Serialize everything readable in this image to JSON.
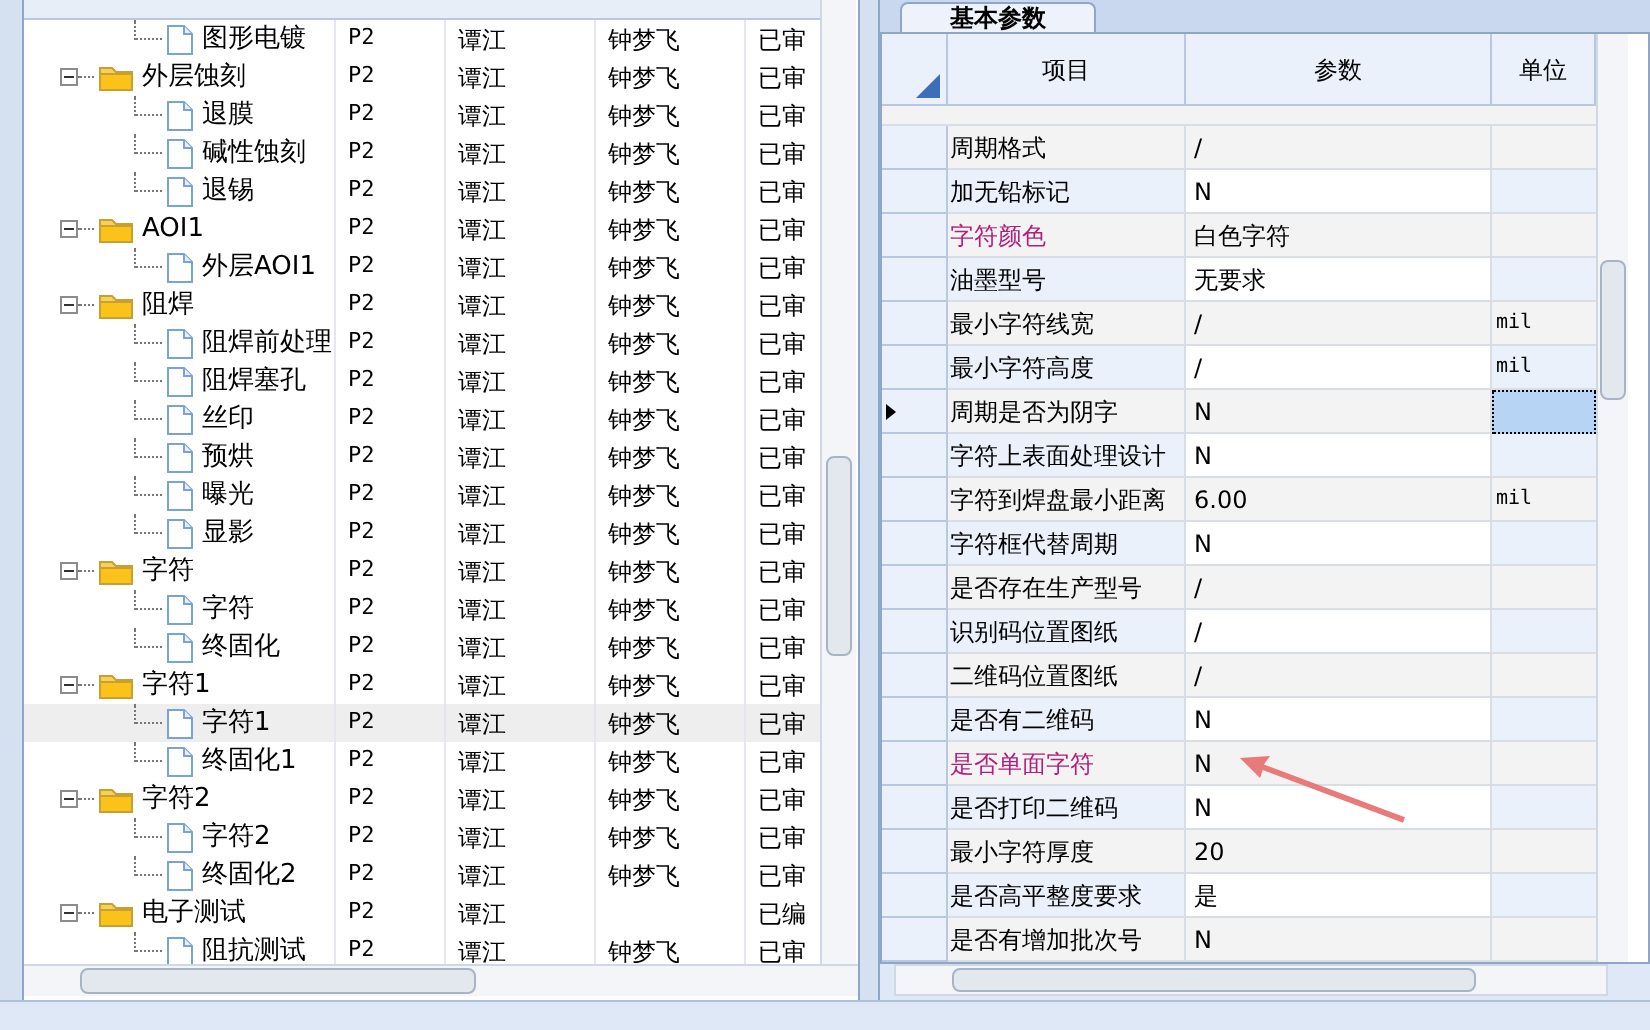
{
  "tree_table": {
    "rows": [
      {
        "label": "图形电镀",
        "kind": "file",
        "p": "P2",
        "writer": "谭江",
        "checker": "钟梦飞",
        "status": "已审",
        "selected": false
      },
      {
        "label": "外层蚀刻",
        "kind": "folder",
        "p": "P2",
        "writer": "谭江",
        "checker": "钟梦飞",
        "status": "已审",
        "selected": false,
        "children": [
          {
            "label": "退膜",
            "kind": "file",
            "p": "P2",
            "writer": "谭江",
            "checker": "钟梦飞",
            "status": "已审",
            "selected": false
          },
          {
            "label": "碱性蚀刻",
            "kind": "file",
            "p": "P2",
            "writer": "谭江",
            "checker": "钟梦飞",
            "status": "已审",
            "selected": false
          },
          {
            "label": "退锡",
            "kind": "file",
            "p": "P2",
            "writer": "谭江",
            "checker": "钟梦飞",
            "status": "已审",
            "selected": false
          }
        ]
      },
      {
        "label": "AOI1",
        "kind": "folder",
        "p": "P2",
        "writer": "谭江",
        "checker": "钟梦飞",
        "status": "已审",
        "selected": false,
        "children": [
          {
            "label": "外层AOI1",
            "kind": "file",
            "p": "P2",
            "writer": "谭江",
            "checker": "钟梦飞",
            "status": "已审",
            "selected": false
          }
        ]
      },
      {
        "label": "阻焊",
        "kind": "folder",
        "p": "P2",
        "writer": "谭江",
        "checker": "钟梦飞",
        "status": "已审",
        "selected": false,
        "children": [
          {
            "label": "阻焊前处理",
            "kind": "file",
            "p": "P2",
            "writer": "谭江",
            "checker": "钟梦飞",
            "status": "已审",
            "selected": false
          },
          {
            "label": "阻焊塞孔",
            "kind": "file",
            "p": "P2",
            "writer": "谭江",
            "checker": "钟梦飞",
            "status": "已审",
            "selected": false
          },
          {
            "label": "丝印",
            "kind": "file",
            "p": "P2",
            "writer": "谭江",
            "checker": "钟梦飞",
            "status": "已审",
            "selected": false
          },
          {
            "label": "预烘",
            "kind": "file",
            "p": "P2",
            "writer": "谭江",
            "checker": "钟梦飞",
            "status": "已审",
            "selected": false
          },
          {
            "label": "曝光",
            "kind": "file",
            "p": "P2",
            "writer": "谭江",
            "checker": "钟梦飞",
            "status": "已审",
            "selected": false
          },
          {
            "label": "显影",
            "kind": "file",
            "p": "P2",
            "writer": "谭江",
            "checker": "钟梦飞",
            "status": "已审",
            "selected": false
          }
        ]
      },
      {
        "label": "字符",
        "kind": "folder",
        "p": "P2",
        "writer": "谭江",
        "checker": "钟梦飞",
        "status": "已审",
        "selected": false,
        "children": [
          {
            "label": "字符",
            "kind": "file",
            "p": "P2",
            "writer": "谭江",
            "checker": "钟梦飞",
            "status": "已审",
            "selected": false
          },
          {
            "label": "终固化",
            "kind": "file",
            "p": "P2",
            "writer": "谭江",
            "checker": "钟梦飞",
            "status": "已审",
            "selected": false
          }
        ]
      },
      {
        "label": "字符1",
        "kind": "folder",
        "p": "P2",
        "writer": "谭江",
        "checker": "钟梦飞",
        "status": "已审",
        "selected": false,
        "children": [
          {
            "label": "字符1",
            "kind": "file",
            "p": "P2",
            "writer": "谭江",
            "checker": "钟梦飞",
            "status": "已审",
            "selected": true
          },
          {
            "label": "终固化1",
            "kind": "file",
            "p": "P2",
            "writer": "谭江",
            "checker": "钟梦飞",
            "status": "已审",
            "selected": false
          }
        ]
      },
      {
        "label": "字符2",
        "kind": "folder",
        "p": "P2",
        "writer": "谭江",
        "checker": "钟梦飞",
        "status": "已审",
        "selected": false,
        "children": [
          {
            "label": "字符2",
            "kind": "file",
            "p": "P2",
            "writer": "谭江",
            "checker": "钟梦飞",
            "status": "已审",
            "selected": false
          },
          {
            "label": "终固化2",
            "kind": "file",
            "p": "P2",
            "writer": "谭江",
            "checker": "钟梦飞",
            "status": "已审",
            "selected": false
          }
        ]
      },
      {
        "label": "电子测试",
        "kind": "folder",
        "p": "P2",
        "writer": "谭江",
        "status": "已编",
        "selected": false,
        "children": [
          {
            "label": "阻抗测试",
            "kind": "file",
            "p": "P2",
            "writer": "谭江",
            "checker": "钟梦飞",
            "status": "已审",
            "selected": false
          }
        ]
      }
    ]
  },
  "param_panel": {
    "tab": {
      "label": "基本参数",
      "selected": true
    },
    "columns": [
      "项目",
      "参数",
      "单位"
    ],
    "rows": [
      {
        "item": "周期格式",
        "value": "/",
        "highlighted": false,
        "current": false
      },
      {
        "item": "加无铅标记",
        "value": "N",
        "highlighted": false,
        "current": false
      },
      {
        "item": "字符颜色",
        "value": "白色字符",
        "highlighted": true,
        "current": false
      },
      {
        "item": "油墨型号",
        "value": "无要求",
        "highlighted": false,
        "current": false
      },
      {
        "item": "最小字符线宽",
        "value": "/",
        "unit": "mil",
        "highlighted": false,
        "current": false
      },
      {
        "item": "最小字符高度",
        "value": "/",
        "unit": "mil",
        "highlighted": false,
        "current": false
      },
      {
        "item": "周期是否为阴字",
        "value": "N",
        "highlighted": false,
        "current": true
      },
      {
        "item": "字符上表面处理设计",
        "value": "N",
        "highlighted": false,
        "current": false
      },
      {
        "item": "字符到焊盘最小距离",
        "value": "6.00",
        "unit": "mil",
        "highlighted": false,
        "current": false
      },
      {
        "item": "字符框代替周期",
        "value": "N",
        "highlighted": false,
        "current": false
      },
      {
        "item": "是否存在生产型号",
        "value": "/",
        "highlighted": false,
        "current": false
      },
      {
        "item": "识别码位置图纸",
        "value": "/",
        "highlighted": false,
        "current": false
      },
      {
        "item": "二维码位置图纸",
        "value": "/",
        "highlighted": false,
        "current": false
      },
      {
        "item": "是否有二维码",
        "value": "N",
        "highlighted": false,
        "current": false
      },
      {
        "item": "是否单面字符",
        "value": "N",
        "highlighted": true,
        "current": false
      },
      {
        "item": "是否打印二维码",
        "value": "N",
        "highlighted": false,
        "current": false
      },
      {
        "item": "最小字符厚度",
        "value": "20",
        "highlighted": false,
        "current": false
      },
      {
        "item": "是否高平整度要求",
        "value": "是",
        "highlighted": false,
        "current": false
      },
      {
        "item": "是否有增加批次号",
        "value": "N",
        "highlighted": false,
        "current": false
      }
    ]
  }
}
